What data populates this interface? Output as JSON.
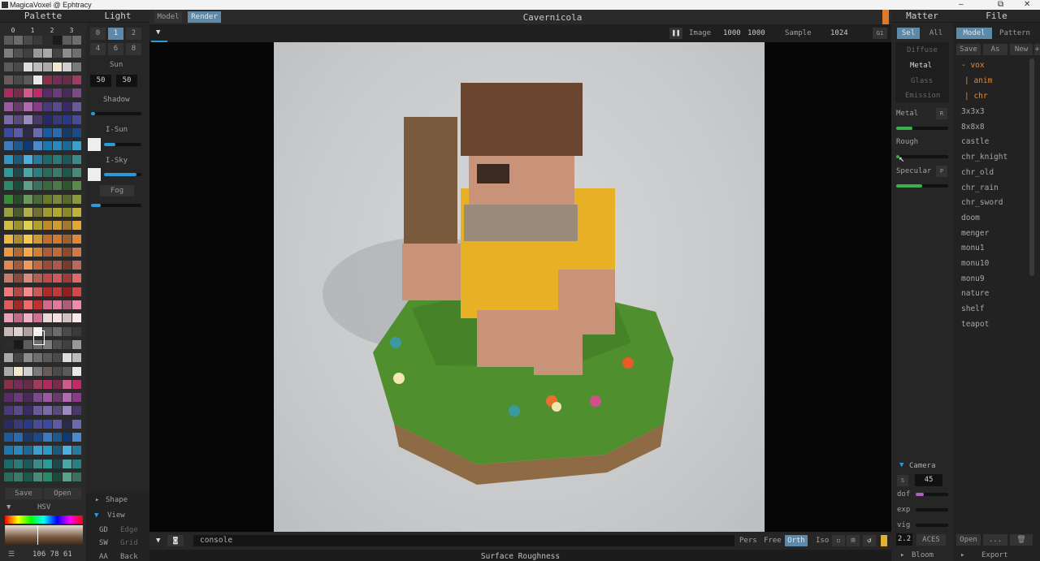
{
  "window": {
    "title": "MagicaVoxel @ Ephtracy",
    "minimize": "–",
    "restore": "⧉",
    "close": "✕"
  },
  "palette": {
    "title": "Palette",
    "tabs": [
      "0",
      "1",
      "2",
      "3"
    ],
    "save": "Save",
    "open": "Open",
    "mode": "HSV",
    "rgb": "106 78 61",
    "colors": [
      "#5b5b5b",
      "#6b6b6b",
      "#4a4a4a",
      "#3a3a3a",
      "#2c2c2c",
      "#1a1a1a",
      "#5d5d5d",
      "#6e6e6e",
      "#7e7e7e",
      "#505050",
      "#404040",
      "#999999",
      "#a8a8a8",
      "#444444",
      "#8c8c8c",
      "#6f6f6f",
      "#5a5a5a",
      "#4a4a4a",
      "#dddddd",
      "#bcbcbc",
      "#aaaaaa",
      "#f2e8d0",
      "#cfcfcf",
      "#7a7a7a",
      "#6a5a5a",
      "#4a4a4a",
      "#5a5a5a",
      "#e8e8e8",
      "#8a3048",
      "#7a2a58",
      "#6a2a48",
      "#a03a5e",
      "#b02a60",
      "#7a2a4a",
      "#d05a88",
      "#c02a68",
      "#5a2a6a",
      "#6a3a7a",
      "#4a2a5a",
      "#7a4a8a",
      "#9a5aa0",
      "#6a3a6a",
      "#b06ab0",
      "#8a3a8a",
      "#4a3a7a",
      "#5a4a8a",
      "#3a2a6a",
      "#6a5a9a",
      "#7a6aaa",
      "#5a4a7a",
      "#9a8ac0",
      "#4a3a6a",
      "#2a2a6a",
      "#3a3a7a",
      "#2a3a8a",
      "#4a4a9a",
      "#3a4aa0",
      "#5a5aa8",
      "#2a2a4a",
      "#6a6ab0",
      "#1a5aa0",
      "#2a6ab0",
      "#1a3a6a",
      "#1a4a8a",
      "#3a7ac0",
      "#1a5a90",
      "#0a3a7a",
      "#4a8ad0",
      "#1a7ab0",
      "#2a8ac0",
      "#1a6a9a",
      "#3aa0d0",
      "#2a9ac8",
      "#1a5a7a",
      "#4ab0e0",
      "#2a7aa0",
      "#1a6a6a",
      "#2a7a7a",
      "#1a5a5a",
      "#3a8a8a",
      "#2a9a9a",
      "#1a4a4a",
      "#4aa8a8",
      "#2a8080",
      "#2a6a5a",
      "#3a7a6a",
      "#1a5a4a",
      "#4a8a7a",
      "#2a8a6a",
      "#1a4a3a",
      "#5aa08a",
      "#3a7060",
      "#3a6a3a",
      "#4a7a4a",
      "#2a5a2a",
      "#5a8a4a",
      "#3a8a3a",
      "#2a4a2a",
      "#6a9a5a",
      "#4a6a3a",
      "#6a7a2a",
      "#7a8a3a",
      "#5a6a2a",
      "#8a9a3a",
      "#9aa040",
      "#4a5a2a",
      "#b0b04a",
      "#707030",
      "#a09a30",
      "#b0a830",
      "#8a8a2a",
      "#c0b040",
      "#d0c040",
      "#9a9030",
      "#e0d050",
      "#b0a030",
      "#c08a2a",
      "#d09a30",
      "#a07a2a",
      "#e0a838",
      "#f0b840",
      "#b08a30",
      "#f8c848",
      "#d09830",
      "#c0702a",
      "#d07a30",
      "#a0602a",
      "#e08838",
      "#f09840",
      "#b06a30",
      "#f8a848",
      "#d08030",
      "#b05a3a",
      "#c06a3a",
      "#904a2a",
      "#d07a4a",
      "#e08a50",
      "#a05a3a",
      "#f09a5a",
      "#c06a40",
      "#9a4a3a",
      "#aa5a4a",
      "#7a3a2a",
      "#ba6a5a",
      "#ca7a6a",
      "#8a4a3a",
      "#da8a7a",
      "#b06050",
      "#c04a4a",
      "#d05a5a",
      "#a03a3a",
      "#e06a6a",
      "#f07a7a",
      "#b04a4a",
      "#f88a8a",
      "#c85a5a",
      "#b02a2a",
      "#c03a3a",
      "#902020",
      "#d04a4a",
      "#e05a5a",
      "#a02a2a",
      "#f06a6a",
      "#c03030",
      "#d06a8a",
      "#e07a9a",
      "#b05a7a",
      "#f08aaa",
      "#e8a0b8",
      "#c06a8a",
      "#f0b0c8",
      "#d07090",
      "#e8d8d8",
      "#f0e0e0",
      "#d0c0c0",
      "#f8e8e8",
      "#c8b8b8",
      "#e0d0d0",
      "#b0a0a0",
      "#f4eeee"
    ]
  },
  "light": {
    "title": "Light",
    "tabs": [
      "0",
      "1",
      "2",
      "4",
      "6",
      "8"
    ],
    "sun_label": "Sun",
    "sun": [
      "50",
      "50"
    ],
    "shadow": "Shadow",
    "isun": "I-Sun",
    "isky": "I-Sky",
    "fog": "Fog"
  },
  "viewport": {
    "tab_model": "Model",
    "tab_render": "Render",
    "title": "Cavernicola",
    "image_label": "Image",
    "image_w": "1000",
    "image_h": "1000",
    "sample_label": "Sample",
    "sample": "1024",
    "console": "console",
    "modes": [
      "Pers",
      "Free",
      "Orth",
      "Iso"
    ],
    "status": "Surface Roughness",
    "g": "G1"
  },
  "bottom_left": {
    "shape": "Shape",
    "view": "View",
    "gd": "GD",
    "edge": "Edge",
    "sw": "SW",
    "grid": "Grid",
    "aa": "AA",
    "back": "Back"
  },
  "matter": {
    "title": "Matter",
    "sel": "Sel",
    "all": "All",
    "types": [
      "Diffuse",
      "Metal",
      "Glass",
      "Emission"
    ],
    "metal": "Metal",
    "metal_btn": "R",
    "rough": "Rough",
    "specular": "Specular",
    "specular_btn": "P",
    "camera": "Camera",
    "fov": "45",
    "dof": "dof",
    "exp": "exp",
    "vig": "vig",
    "gamma": "2.2",
    "aces": "ACES",
    "bloom": "Bloom"
  },
  "file": {
    "title": "File",
    "tab_model": "Model",
    "tab_pattern": "Pattern",
    "save": "Save",
    "as": "As",
    "new": "New",
    "plus": "+",
    "folder": "- vox",
    "sub": [
      "| anim",
      "| chr"
    ],
    "items": [
      "3x3x3",
      "8x8x8",
      "castle",
      "chr_knight",
      "chr_old",
      "chr_rain",
      "chr_sword",
      "doom",
      "menger",
      "monu1",
      "monu10",
      "monu9",
      "nature",
      "shelf",
      "teapot"
    ],
    "open": "Open",
    "dots": "...",
    "export": "Export"
  }
}
